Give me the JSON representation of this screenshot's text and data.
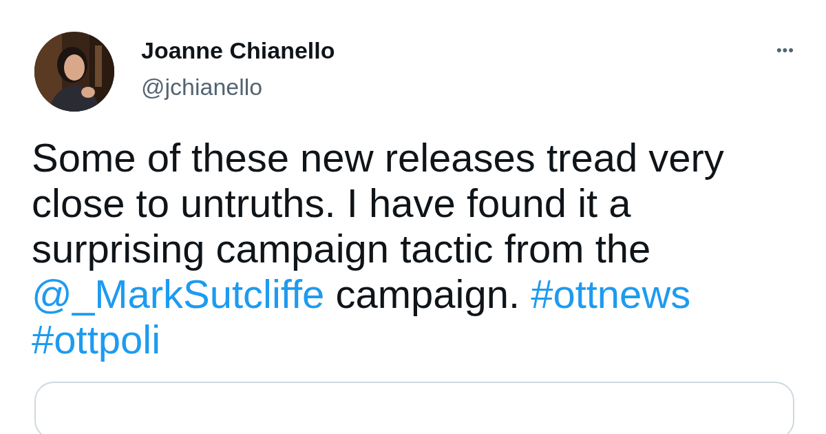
{
  "author": {
    "name": "Joanne Chianello",
    "handle": "@jchianello"
  },
  "more_icon": "•••",
  "body": [
    {
      "kind": "text",
      "text": "Some of these new releases tread very close to untruths. I have found it a surprising campaign tactic from the "
    },
    {
      "kind": "mention",
      "text": "@_MarkSutcliffe"
    },
    {
      "kind": "text",
      "text": " campaign. "
    },
    {
      "kind": "hashtag",
      "text": "#ottnews"
    },
    {
      "kind": "hashtag",
      "text": "#ottpoli"
    }
  ]
}
